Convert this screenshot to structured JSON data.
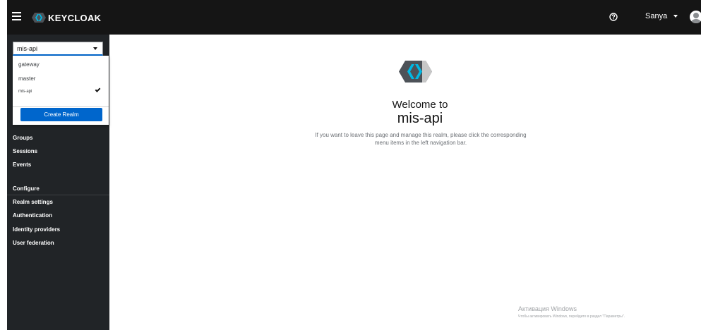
{
  "header": {
    "brand_bold": "KEYCLOAK",
    "user_name": "Sanya"
  },
  "realm_selector": {
    "selected": "mis-api",
    "options": [
      "gateway",
      "master",
      "mis-api"
    ],
    "create_label": "Create Realm"
  },
  "sidebar": {
    "items_top": [
      "Groups",
      "Sessions",
      "Events"
    ],
    "section_configure": "Configure",
    "items_configure": [
      "Realm settings",
      "Authentication",
      "Identity providers",
      "User federation"
    ]
  },
  "main": {
    "welcome": "Welcome to",
    "realm_name": "mis-api",
    "description_line1": "If you want to leave this page and manage this realm, please click the corresponding",
    "description_line2": "menu items in the left navigation bar."
  },
  "watermark": {
    "title": "Активация Windows",
    "subtitle": "Чтобы активировать Windows, перейдите в раздел \"Параметры\"."
  },
  "colors": {
    "header_bg": "#151515",
    "sidebar_bg": "#212427",
    "primary": "#0066cc",
    "logo_dark": "#4d5258",
    "logo_blue": "#00b9e4"
  }
}
